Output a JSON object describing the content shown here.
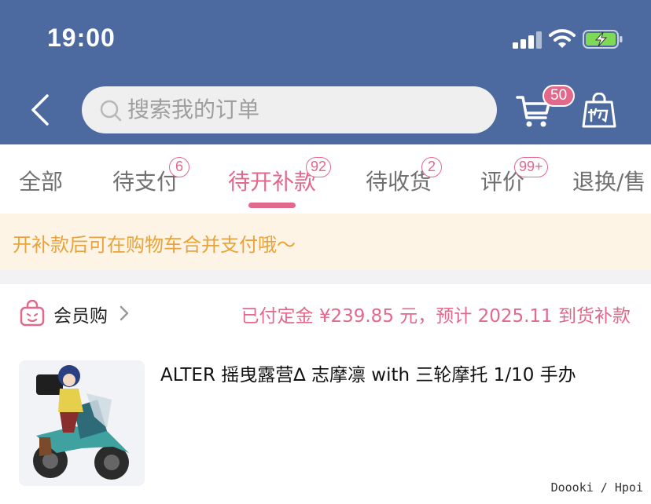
{
  "status_bar": {
    "time": "19:00"
  },
  "header": {
    "search_placeholder": "搜索我的订单",
    "cart_badge": "50"
  },
  "tabs": [
    {
      "label": "全部"
    },
    {
      "label": "待支付",
      "badge": "6"
    },
    {
      "label": "待开补款",
      "badge": "92",
      "active": true
    },
    {
      "label": "待收货",
      "badge": "2"
    },
    {
      "label": "评价",
      "badge": "99+"
    },
    {
      "label": "退换/售"
    }
  ],
  "notice": {
    "text": "开补款后可在购物车合并支付哦～"
  },
  "order": {
    "shop_name": "会员购",
    "deposit_text": "已付定金 ¥239.85 元，预计 2025.11 到货补款",
    "product_title": "ALTER 摇曳露营∆ 志摩凛 with 三轮摩托 1/10 手办"
  },
  "watermark": "Doooki / Hpoi",
  "colors": {
    "header_bg": "#4c6aa0",
    "accent": "#e2698c",
    "notice_bg": "#fdf4e6",
    "notice_text": "#e8a33c"
  },
  "icons": [
    "back-arrow-icon",
    "search-icon",
    "cart-icon",
    "shopping-bag-icon",
    "shop-icon",
    "chevron-right-icon"
  ]
}
